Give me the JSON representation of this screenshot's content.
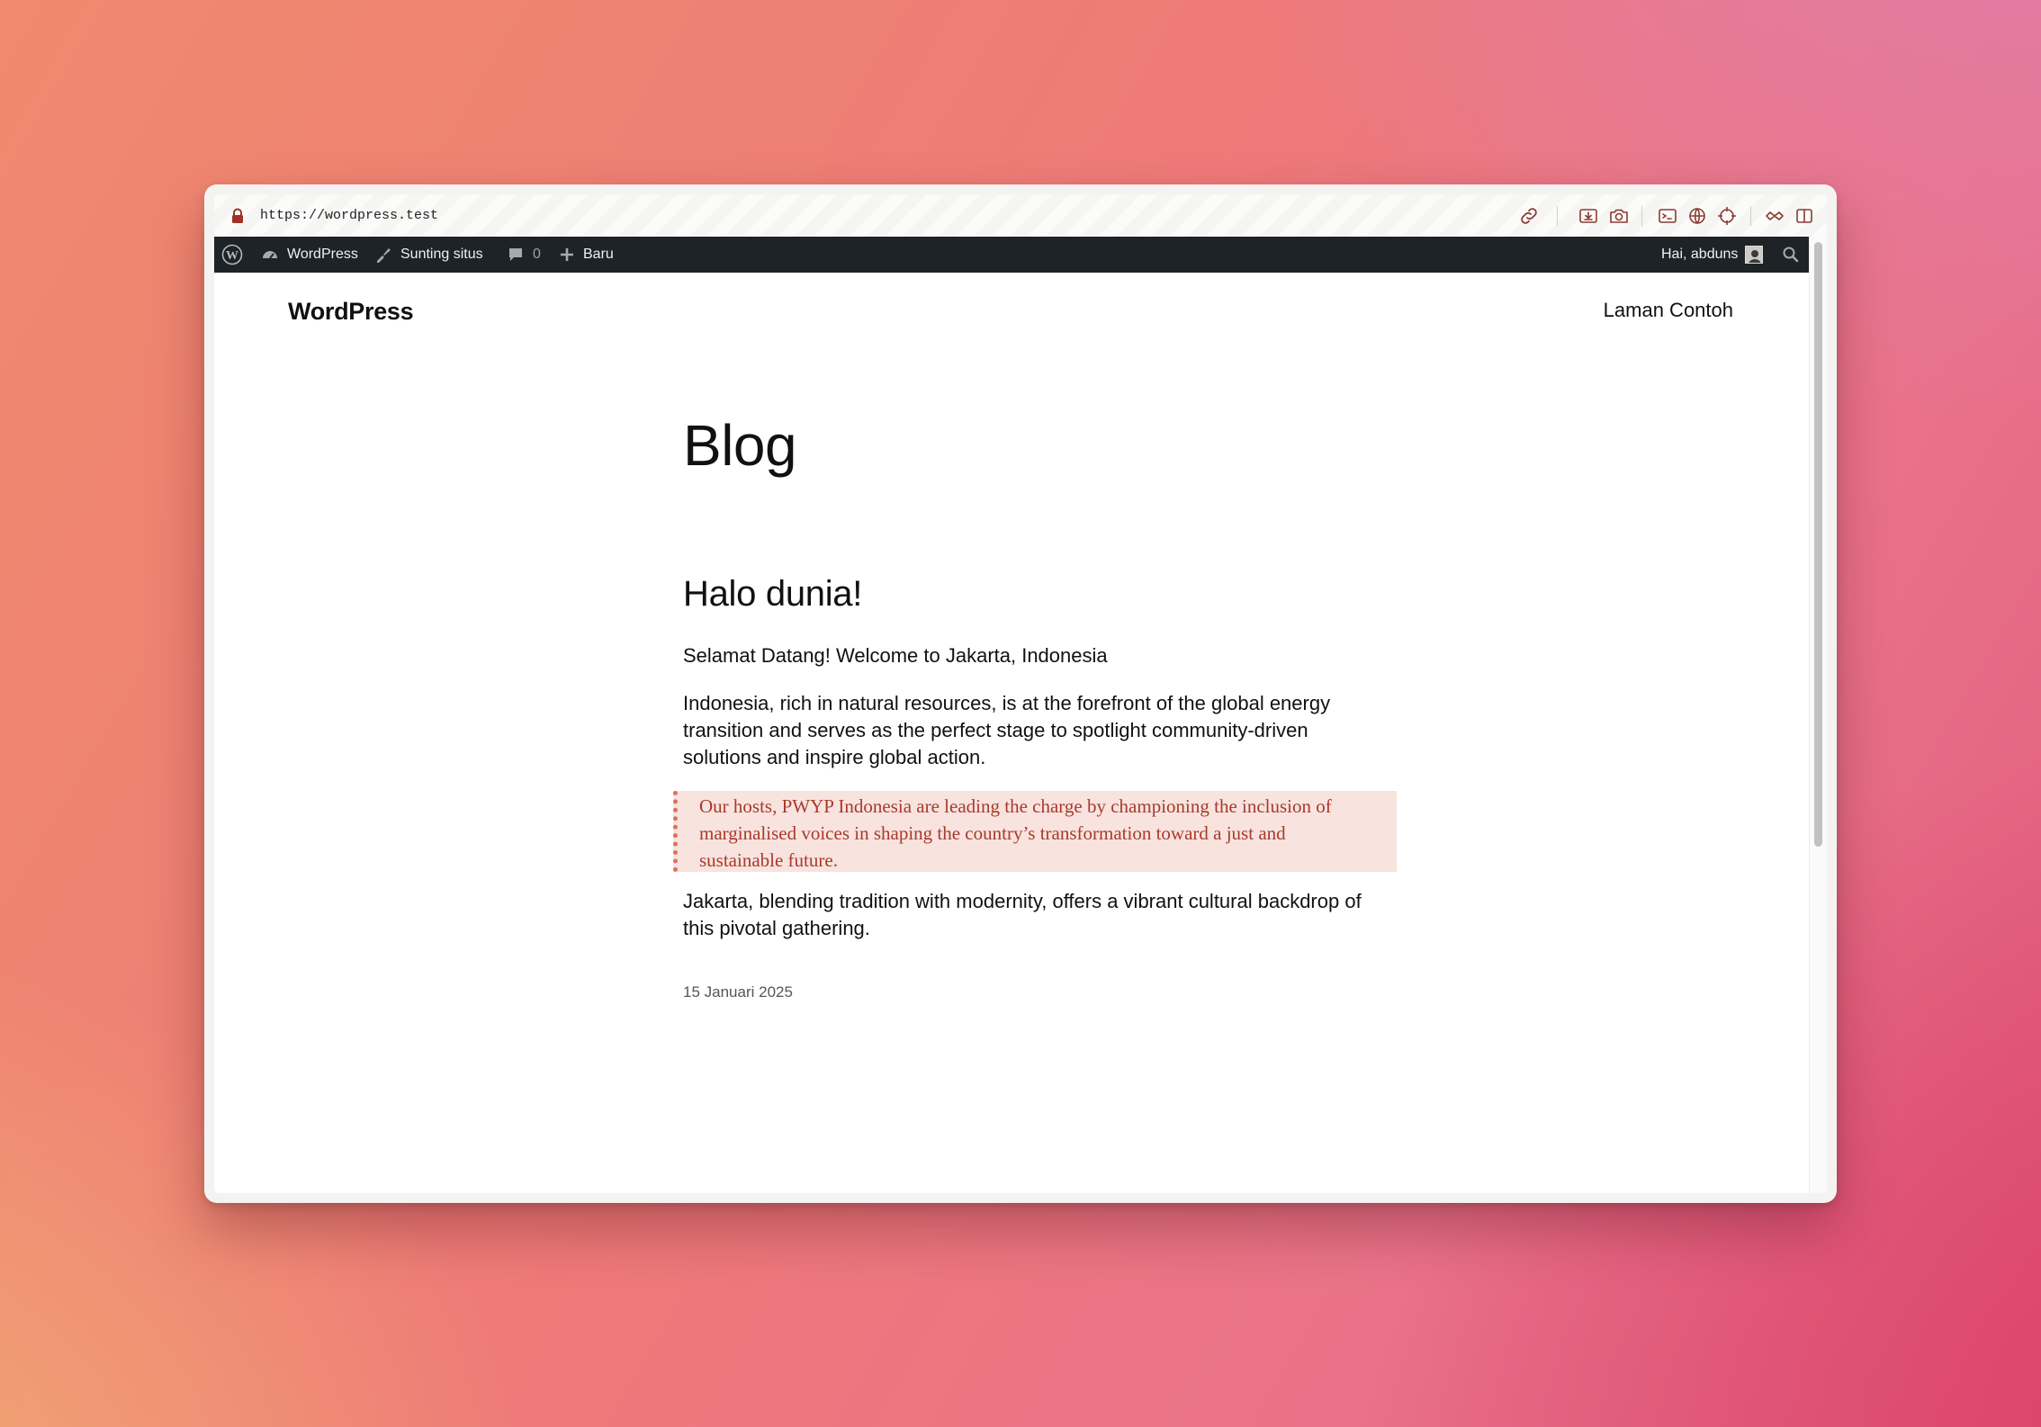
{
  "browser": {
    "url": "https://wordpress.test",
    "icons": [
      "link-icon",
      "download-icon",
      "camera-icon",
      "terminal-icon",
      "globe-icon",
      "crosshair-icon",
      "extensions-icon",
      "split-view-icon"
    ]
  },
  "admin_bar": {
    "site_name": "WordPress",
    "edit_site": "Sunting situs",
    "comments_count": "0",
    "new_label": "Baru",
    "greeting": "Hai, abduns"
  },
  "site": {
    "title": "WordPress",
    "nav": [
      "Laman Contoh"
    ]
  },
  "page": {
    "title": "Blog"
  },
  "post": {
    "title": "Halo dunia!",
    "paragraphs": [
      "Selamat Datang! Welcome to Jakarta, Indonesia",
      "Indonesia, rich in natural resources, is at the forefront of the global energy transition and serves as the perfect stage to spotlight community-driven solutions and inspire global action."
    ],
    "quote": "Our hosts, PWYP Indonesia are leading the charge by championing the inclusion of marginalised voices in shaping the country’s transformation toward a just and sustainable future.",
    "closing": "Jakarta, blending tradition with modernity, offers a vibrant cultural backdrop of this pivotal gathering.",
    "date": "15 Januari 2025"
  },
  "colors": {
    "admin_bar": "#1d2327",
    "quote_background": "#f8e3df",
    "quote_text": "#a83a2a",
    "quote_border": "#e0705e"
  }
}
